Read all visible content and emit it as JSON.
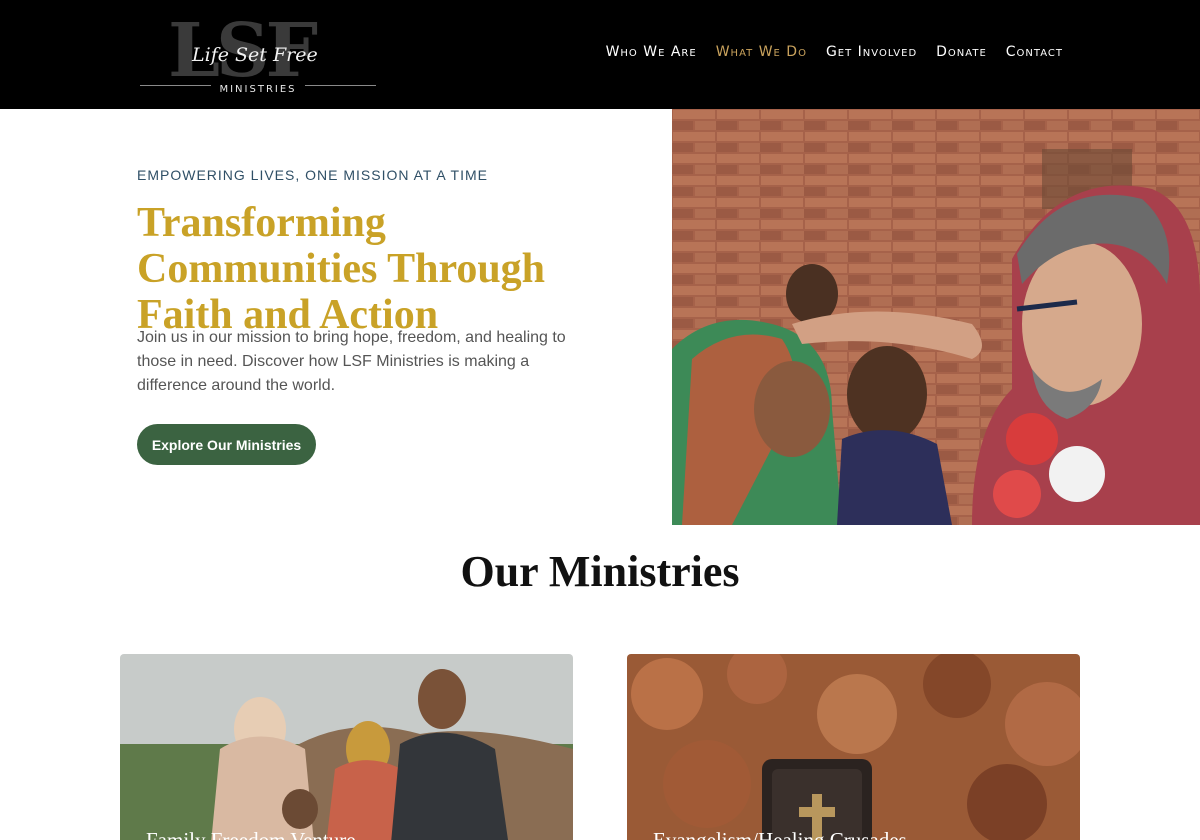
{
  "header": {
    "logo": {
      "letters": "LSF",
      "script": "Life Set Free",
      "subtitle": "MINISTRIES"
    },
    "nav": [
      {
        "label": "Who We Are",
        "active": false
      },
      {
        "label": "What We Do",
        "active": true
      },
      {
        "label": "Get Involved",
        "active": false
      },
      {
        "label": "Donate",
        "active": false
      },
      {
        "label": "Contact",
        "active": false
      }
    ]
  },
  "hero": {
    "eyebrow": "EMPOWERING LIVES, ONE MISSION AT A TIME",
    "title": "Transforming Communities Through Faith and Action",
    "text": "Join us in our mission to bring hope, freedom, and healing to those in need. Discover how LSF Ministries is making a difference around the world.",
    "button_label": "Explore Our Ministries"
  },
  "ministries": {
    "title": "Our Ministries",
    "cards": [
      {
        "title": "Family Freedom Venture"
      },
      {
        "title": "Evangelism/Healing Crusades"
      }
    ]
  },
  "colors": {
    "header_bg": "#000000",
    "nav_active": "#c9a25c",
    "title_gold": "#c9a227",
    "eyebrow": "#2f4f66",
    "button_green": "#3b6341"
  }
}
